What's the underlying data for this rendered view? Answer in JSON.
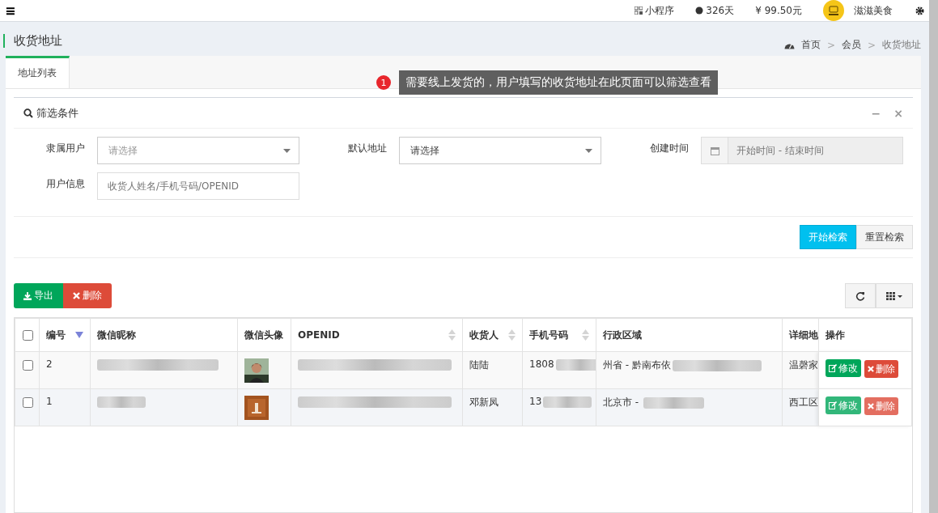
{
  "topbar": {
    "menu_icon": "≡",
    "items": [
      {
        "kind": "qrcode",
        "text": "小程序"
      },
      {
        "kind": "sun",
        "text": "326天"
      },
      {
        "kind": "plain",
        "text": "¥ 99.50元"
      }
    ],
    "user": {
      "name": "滋滋美食"
    }
  },
  "page": {
    "title": "收货地址",
    "breadcrumb": [
      "首页",
      "会员",
      "收货地址"
    ],
    "breadcrumb_separator": ">"
  },
  "tabs": [
    {
      "label": "地址列表",
      "selected": true
    }
  ],
  "tooltip": {
    "number": "1",
    "text": "需要线上发货的，用户填写的收货地址在此页面可以筛选查看"
  },
  "filter": {
    "title": "筛选条件",
    "minimize": "−",
    "close": "×",
    "fields": [
      {
        "kind": "select",
        "label": "隶属用户",
        "placeholder": "请选择"
      },
      {
        "kind": "select",
        "label": "默认地址",
        "value": "请选择"
      },
      {
        "kind": "daterange",
        "label": "创建时间",
        "placeholder": "开始时间 - 结束时间"
      },
      {
        "kind": "text",
        "label": "用户信息",
        "placeholder": "收货人姓名/手机号码/OPENID"
      }
    ],
    "buttons": [
      {
        "label": "开始检索",
        "primary": true
      },
      {
        "label": "重置检索",
        "primary": false
      }
    ]
  },
  "toolbar": {
    "buttons": [
      {
        "kind": "export",
        "label": "导出"
      },
      {
        "kind": "delete",
        "label": "删除"
      }
    ]
  },
  "table": {
    "all_checked": false,
    "columns": [
      {
        "label": "编号",
        "sortable": true,
        "sorted": true
      },
      {
        "label": "微信昵称",
        "sortable": false,
        "sorted": false
      },
      {
        "label": "微信头像",
        "sortable": false,
        "sorted": false
      },
      {
        "label": "OPENID",
        "sortable": true,
        "sorted": false
      },
      {
        "label": "收货人",
        "sortable": true,
        "sorted": false
      },
      {
        "label": "手机号码",
        "sortable": true,
        "sorted": false
      },
      {
        "label": "行政区域",
        "sortable": false,
        "sorted": false
      },
      {
        "label": "详细地"
      },
      {
        "label": "操作",
        "sortable": false,
        "sorted": false
      }
    ],
    "rows": [
      {
        "checked": false,
        "hovered": false,
        "id": "2",
        "receiver": "陆陆",
        "phone": "1808",
        "region": "州省 - 黔南布依",
        "detail": "温磬家",
        "actions": [
          "修改",
          "删除"
        ]
      },
      {
        "checked": false,
        "hovered": true,
        "id": "1",
        "receiver": "邓新凤",
        "phone": "13",
        "region": "北京市 - ",
        "detail": "西工区",
        "actions": [
          "修改",
          "删除"
        ]
      }
    ]
  }
}
